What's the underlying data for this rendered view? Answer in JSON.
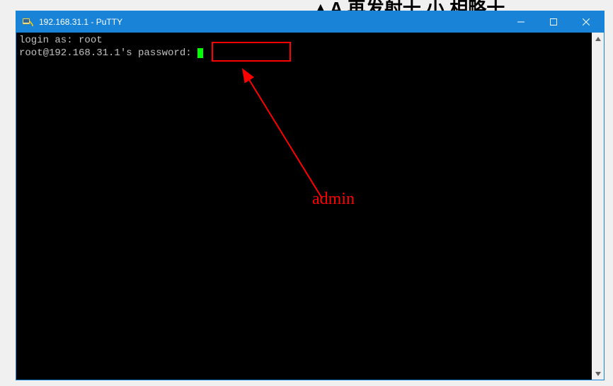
{
  "background": {
    "partial_text": "▲A  再发射十 小  相略十"
  },
  "window": {
    "title": "192.168.31.1 - PuTTY",
    "icon": "putty-icon"
  },
  "terminal": {
    "lines": [
      {
        "prompt": "login as: ",
        "value": "root"
      },
      {
        "prompt": "root@192.168.31.1's password: ",
        "value": ""
      }
    ]
  },
  "annotations": {
    "box_target": "password-input-area",
    "arrow_label": "admin"
  },
  "colors": {
    "titlebar": "#1883d7",
    "terminal_bg": "#000000",
    "terminal_fg": "#c0c0c0",
    "cursor": "#00ff00",
    "annotation": "#ff0000"
  }
}
